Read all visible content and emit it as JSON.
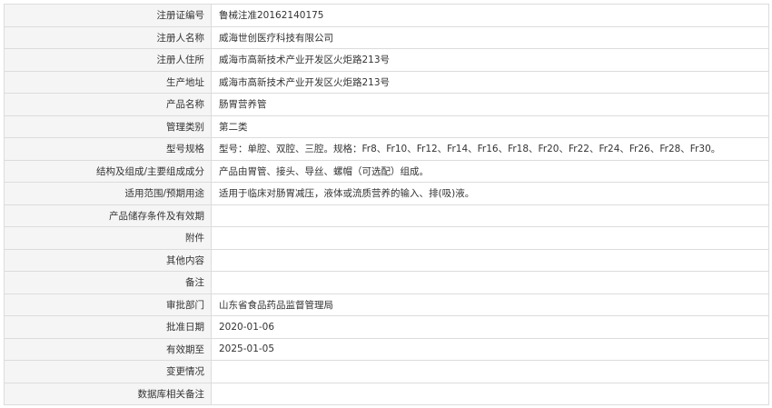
{
  "rows": [
    {
      "label": "注册证编号",
      "value": "鲁械注准20162140175"
    },
    {
      "label": "注册人名称",
      "value": "威海世创医疗科技有限公司"
    },
    {
      "label": "注册人住所",
      "value": "威海市高新技术产业开发区火炬路213号"
    },
    {
      "label": "生产地址",
      "value": "威海市高新技术产业开发区火炬路213号"
    },
    {
      "label": "产品名称",
      "value": "肠胃营养管"
    },
    {
      "label": "管理类别",
      "value": "第二类"
    },
    {
      "label": "型号规格",
      "value": "型号：单腔、双腔、三腔。规格：Fr8、Fr10、Fr12、Fr14、Fr16、Fr18、Fr20、Fr22、Fr24、Fr26、Fr28、Fr30。"
    },
    {
      "label": "结构及组成/主要组成成分",
      "value": "产品由胃管、接头、导丝、螺帽（可选配）组成。"
    },
    {
      "label": "适用范围/预期用途",
      "value": "适用于临床对肠胃减压，液体或流质营养的输入、排(吸)液。"
    },
    {
      "label": "产品储存条件及有效期",
      "value": ""
    },
    {
      "label": "附件",
      "value": ""
    },
    {
      "label": "其他内容",
      "value": ""
    },
    {
      "label": "备注",
      "value": ""
    },
    {
      "label": "审批部门",
      "value": "山东省食品药品监督管理局"
    },
    {
      "label": "批准日期",
      "value": "2020-01-06"
    },
    {
      "label": "有效期至",
      "value": "2025-01-05"
    },
    {
      "label": "变更情况",
      "value": ""
    },
    {
      "label": "数据库相关备注",
      "value": ""
    }
  ]
}
